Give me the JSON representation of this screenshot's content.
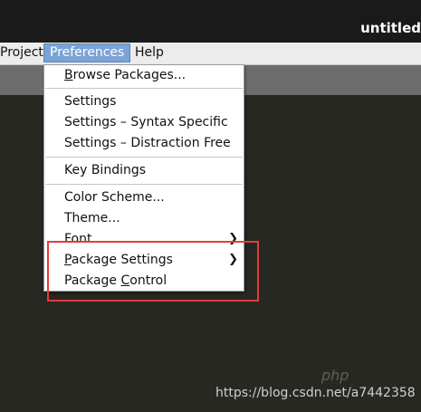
{
  "window": {
    "title": "untitled"
  },
  "menubar": {
    "items": [
      "Project",
      "Preferences",
      "Help"
    ]
  },
  "preferences_menu": {
    "browse_packages": "Browse Packages...",
    "settings": "Settings",
    "settings_syntax": "Settings – Syntax Specific",
    "settings_distraction": "Settings – Distraction Free",
    "key_bindings": "Key Bindings",
    "color_scheme": "Color Scheme...",
    "theme": "Theme...",
    "font": "Font",
    "package_settings": "Package Settings",
    "package_control": "Package Control"
  },
  "watermark": {
    "url": "https://blog.csdn.net/a7442358",
    "logo": "php"
  },
  "colors": {
    "highlight": "#e43b3b",
    "menu_active": "#7ba3d6",
    "editor_bg": "#272822"
  }
}
